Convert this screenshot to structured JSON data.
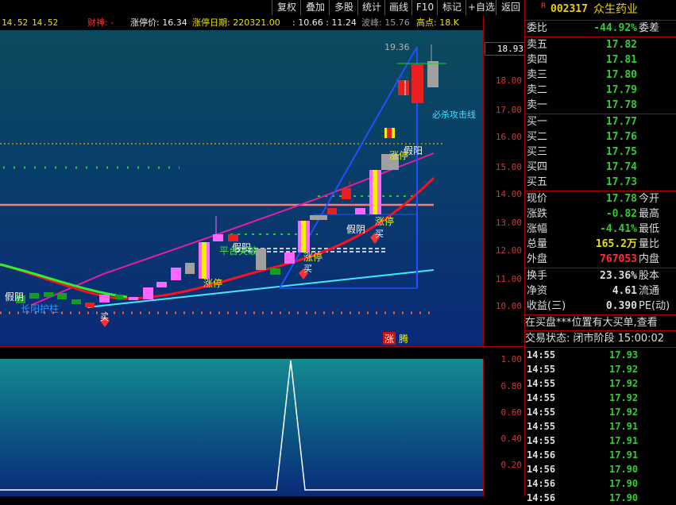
{
  "toolbar": {
    "buttons": [
      "复权",
      "叠加",
      "多股",
      "统计",
      "画线",
      "F10",
      "标记",
      "+自选",
      "返回"
    ]
  },
  "infobar": {
    "left_vals": [
      "14.52",
      "14.52"
    ],
    "caishen": "财神: -",
    "limit_price_label": "涨停价: 16.34",
    "limit_date_label": "涨停日期: 220321.00",
    "range_vals": ": 10.66 : 11.24",
    "wave_label": "波峰: 15.76",
    "high_label": "高点: 18.K"
  },
  "chart": {
    "price_ticks": [
      "18.00",
      "17.00",
      "16.00",
      "15.00",
      "14.00",
      "13.00",
      "12.00",
      "11.00",
      "10.00"
    ],
    "current_price_tag": "18.93",
    "peak_label": "19.36",
    "annotation_bisha": "必杀攻击线",
    "labels_jiayang": [
      "假阴",
      "假阳",
      "假阴",
      "假阳"
    ],
    "labels_zhangting": [
      "涨停",
      "涨停",
      "涨停",
      "涨停"
    ],
    "labels_buy": [
      "买",
      "买",
      "买"
    ],
    "label_changyang": "长阳护柱",
    "label_pingtai": "平台突破",
    "badge_zhang": "涨",
    "badge_teng": "腾",
    "sub_ticks": [
      "1.00",
      "0.80",
      "0.60",
      "0.40",
      "0.20"
    ]
  },
  "quote": {
    "code_badge": "R",
    "code": "002317",
    "name": "众生药业",
    "weibi_label": "委比",
    "weibi_value": "-44.92%",
    "weicha_label": "委差",
    "asks": [
      {
        "label": "卖五",
        "price": "17.82"
      },
      {
        "label": "卖四",
        "price": "17.81"
      },
      {
        "label": "卖三",
        "price": "17.80"
      },
      {
        "label": "卖二",
        "price": "17.79"
      },
      {
        "label": "卖一",
        "price": "17.78"
      }
    ],
    "bids": [
      {
        "label": "买一",
        "price": "17.77"
      },
      {
        "label": "买二",
        "price": "17.76"
      },
      {
        "label": "买三",
        "price": "17.75"
      },
      {
        "label": "买四",
        "price": "17.74"
      },
      {
        "label": "买五",
        "price": "17.73"
      }
    ],
    "stats": [
      {
        "label": "现价",
        "value": "17.78",
        "right": "今开",
        "color": "#33cc33"
      },
      {
        "label": "涨跌",
        "value": "-0.82",
        "right": "最高",
        "color": "#33cc33"
      },
      {
        "label": "涨幅",
        "value": "-4.41%",
        "right": "最低",
        "color": "#33cc33"
      },
      {
        "label": "总量",
        "value": "165.2万",
        "right": "量比",
        "color": "#e8e000"
      },
      {
        "label": "外盘",
        "value": "767053",
        "right": "内盘",
        "color": "#ff3030"
      }
    ],
    "stats2": [
      {
        "label": "换手",
        "value": "23.36%",
        "right": "股本",
        "color": "#dddddd"
      },
      {
        "label": "净资",
        "value": "4.61",
        "right": "流通",
        "color": "#dddddd"
      },
      {
        "label": "收益(三)",
        "value": "0.390",
        "right": "PE(动)",
        "color": "#dddddd"
      }
    ],
    "notice": "在买盘***位置有大买单,查看",
    "trade_status": "交易状态: 闭市阶段 15:00:02"
  },
  "ticks": [
    {
      "time": "14:55",
      "price": "17.93"
    },
    {
      "time": "14:55",
      "price": "17.92"
    },
    {
      "time": "14:55",
      "price": "17.92"
    },
    {
      "time": "14:55",
      "price": "17.92"
    },
    {
      "time": "14:55",
      "price": "17.92"
    },
    {
      "time": "14:55",
      "price": "17.91"
    },
    {
      "time": "14:55",
      "price": "17.91"
    },
    {
      "time": "14:56",
      "price": "17.91"
    },
    {
      "time": "14:56",
      "price": "17.90"
    },
    {
      "time": "14:56",
      "price": "17.90"
    },
    {
      "time": "14:56",
      "price": "17.90"
    }
  ]
}
